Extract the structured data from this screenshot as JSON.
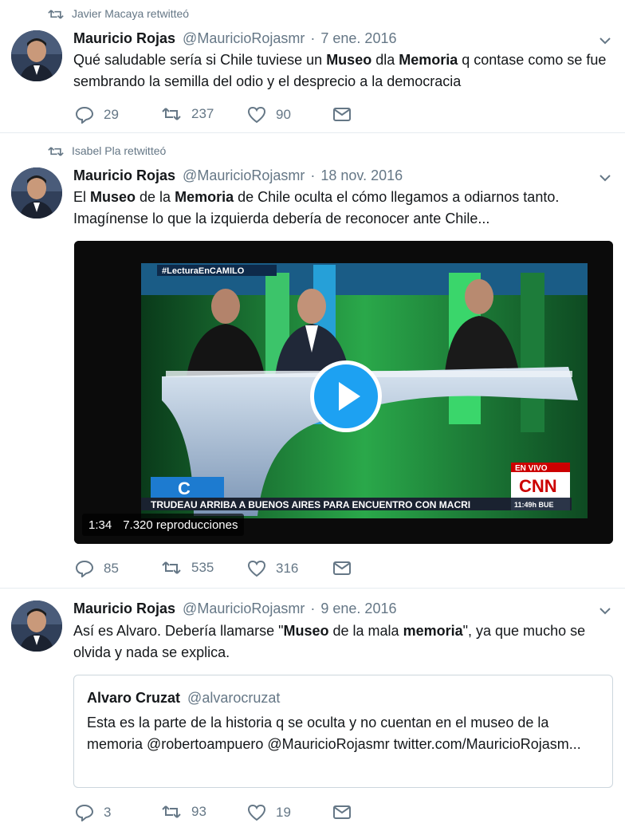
{
  "tweets": [
    {
      "retweeted_by": "Javier Macaya retwitteó",
      "name": "Mauricio Rojas",
      "handle": "@MauricioRojasmr",
      "date": "7 ene. 2016",
      "text_parts": [
        "Qué saludable sería si Chile tuviese un ",
        "Museo",
        " dla ",
        "Memoria",
        " q contase como se fue sembrando la semilla del odio y el desprecio a la democracia"
      ],
      "replies": "29",
      "retweets": "237",
      "likes": "90"
    },
    {
      "retweeted_by": "Isabel Pla retwitteó",
      "name": "Mauricio Rojas",
      "handle": "@MauricioRojasmr",
      "date": "18 nov. 2016",
      "text_parts": [
        "El ",
        "Museo",
        " de la ",
        "Memoria",
        " de Chile oculta el cómo llegamos a odiarnos tanto. Imagínense lo que la izquierda debería de reconocer ante Chile..."
      ],
      "video": {
        "hashtag": "#LecturaEnCAMILO",
        "live_label": "EN VIVO",
        "network": "CNN",
        "ticker": "TRUDEAU ARRIBA A BUENOS AIRES PARA ENCUENTRO CON MACRI",
        "clock": "11:49h BUE",
        "duration": "1:34",
        "views": "7.320 reproducciones"
      },
      "replies": "85",
      "retweets": "535",
      "likes": "316"
    },
    {
      "name": "Mauricio Rojas",
      "handle": "@MauricioRojasmr",
      "date": "9 ene. 2016",
      "text_parts": [
        "Así es Alvaro. Debería llamarse \"",
        "Museo",
        " de la mala ",
        "memoria",
        "\", ya que mucho se olvida y nada se explica."
      ],
      "quote": {
        "name": "Alvaro Cruzat",
        "handle": "@alvarocruzat",
        "text": "Esta es la parte de la historia q se oculta y no cuentan en el museo de la memoria @robertoampuero @MauricioRojasmr twitter.com/MauricioRojasm..."
      },
      "replies": "3",
      "retweets": "93",
      "likes": "19"
    }
  ],
  "colors": {
    "accent": "#1da1f2",
    "muted": "#657786",
    "text": "#14171a",
    "border": "#e6ecf0"
  },
  "icons": [
    "retweet-icon",
    "reply-icon",
    "like-icon",
    "dm-icon",
    "caret-down-icon",
    "play-icon"
  ]
}
